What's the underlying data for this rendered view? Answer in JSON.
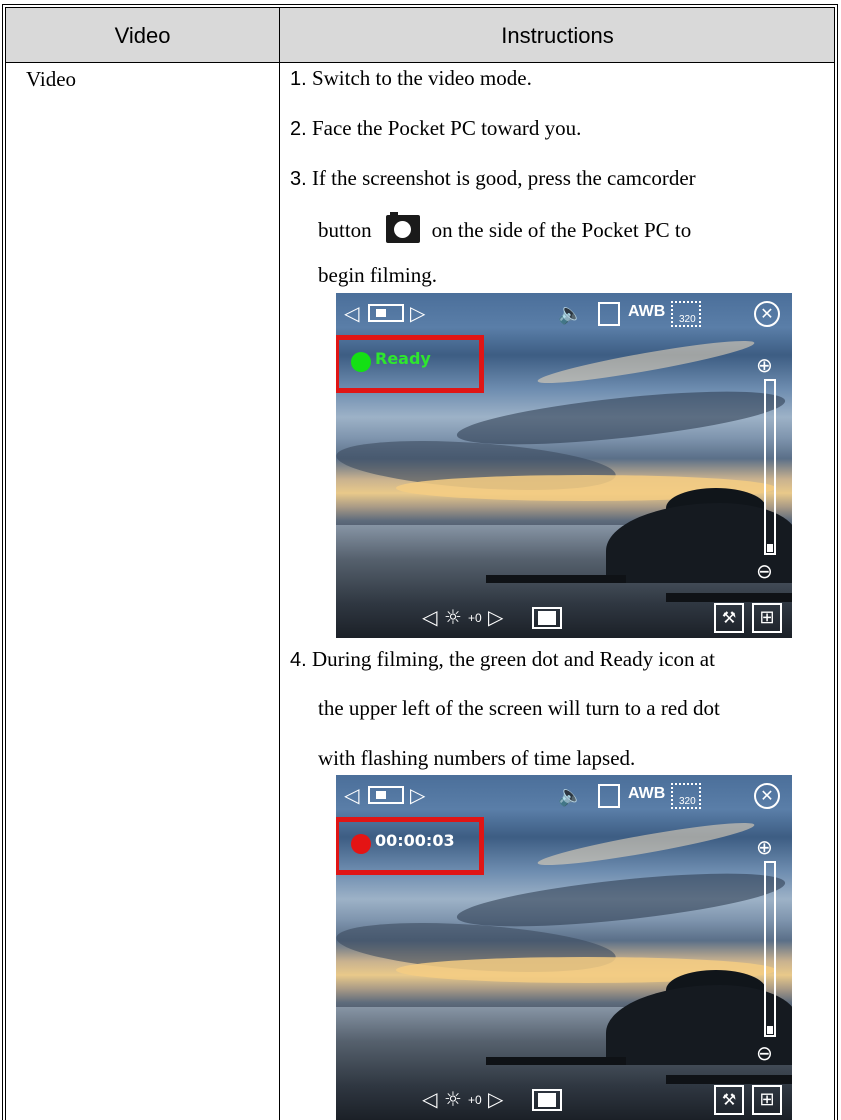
{
  "table": {
    "header": {
      "col1": "Video",
      "col2": "Instructions"
    },
    "left_cell": "Video",
    "steps": [
      {
        "num": "1.",
        "text": " Switch to the video mode."
      },
      {
        "num": "2.",
        "text": " Face the Pocket PC toward you."
      },
      {
        "num": "3.",
        "line1": " If the screenshot is good, press the camcorder",
        "line2a": "button",
        "line2b": "on the side of the Pocket PC to",
        "line3": "begin filming."
      },
      {
        "num": "4.",
        "line1": " During filming, the green dot and Ready icon at",
        "line2": "the upper left of the screen will turn to a red dot",
        "line3": "with flashing numbers of time lapsed."
      }
    ]
  },
  "screenshot1": {
    "status_text": "Ready",
    "status_color": "#2ee62e",
    "status_dot_color": "#14e014",
    "awb_label": "AWB",
    "resolution_label": "320",
    "ev_value": "+0"
  },
  "screenshot2": {
    "status_text": "00:00:03",
    "status_color": "#ffffff",
    "status_dot_color": "#e41414",
    "awb_label": "AWB",
    "resolution_label": "320",
    "ev_value": "+0"
  },
  "icons": {
    "camcorder_button": "camera-icon",
    "nav_left": "triangle-left-icon",
    "nav_right": "triangle-right-icon",
    "speaker": "speaker-icon",
    "storage": "storage-card-icon",
    "close": "close-icon",
    "zoom_in": "zoom-in-icon",
    "zoom_out": "zoom-out-icon",
    "brightness": "sun-icon",
    "tools": "tools-icon",
    "grid": "grid-icon"
  },
  "colors": {
    "highlight_box": "#e01515",
    "header_bg": "#d9d9d9"
  }
}
